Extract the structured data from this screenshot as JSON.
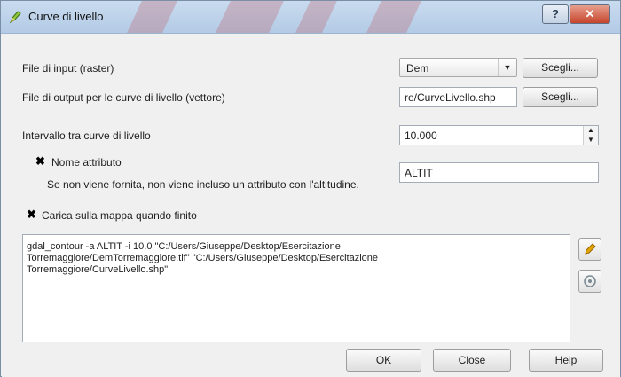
{
  "window": {
    "title": "Curve di livello",
    "help_glyph": "?",
    "close_glyph": "✕"
  },
  "form": {
    "input_label": "File di input (raster)",
    "input_value": "Dem",
    "browse1_label": "Scegli...",
    "output_label": "File di output per le curve di livello (vettore)",
    "output_value": "re/CurveLivello.shp",
    "browse2_label": "Scegli...",
    "interval_label": "Intervallo tra curve di livello",
    "interval_value": "10.000",
    "attr_checkbox_label": "Nome attributo",
    "attr_checked": true,
    "attr_value": "ALTIT",
    "attr_hint": "Se non viene fornita, non viene incluso un attributo con l'altitudine.",
    "load_label": "Carica sulla mappa quando finito",
    "load_checked": true
  },
  "command": {
    "lines": [
      "gdal_contour -a ALTIT -i 10.0 \"C:/Users/Giuseppe/Desktop/Esercitazione",
      "Torremaggiore/DemTorremaggiore.tif\" \"C:/Users/Giuseppe/Desktop/Esercitazione",
      "Torremaggiore/CurveLivello.shp\""
    ]
  },
  "buttons": {
    "ok": "OK",
    "close": "Close",
    "help": "Help"
  },
  "colors": {
    "titlebar": "#b3cbe6",
    "close_red": "#c6442c",
    "edit_icon": "#e2a400"
  },
  "icons": {
    "app": "qgis-pencil-icon",
    "edit": "pencil-icon",
    "reset": "reset-circle-icon"
  }
}
